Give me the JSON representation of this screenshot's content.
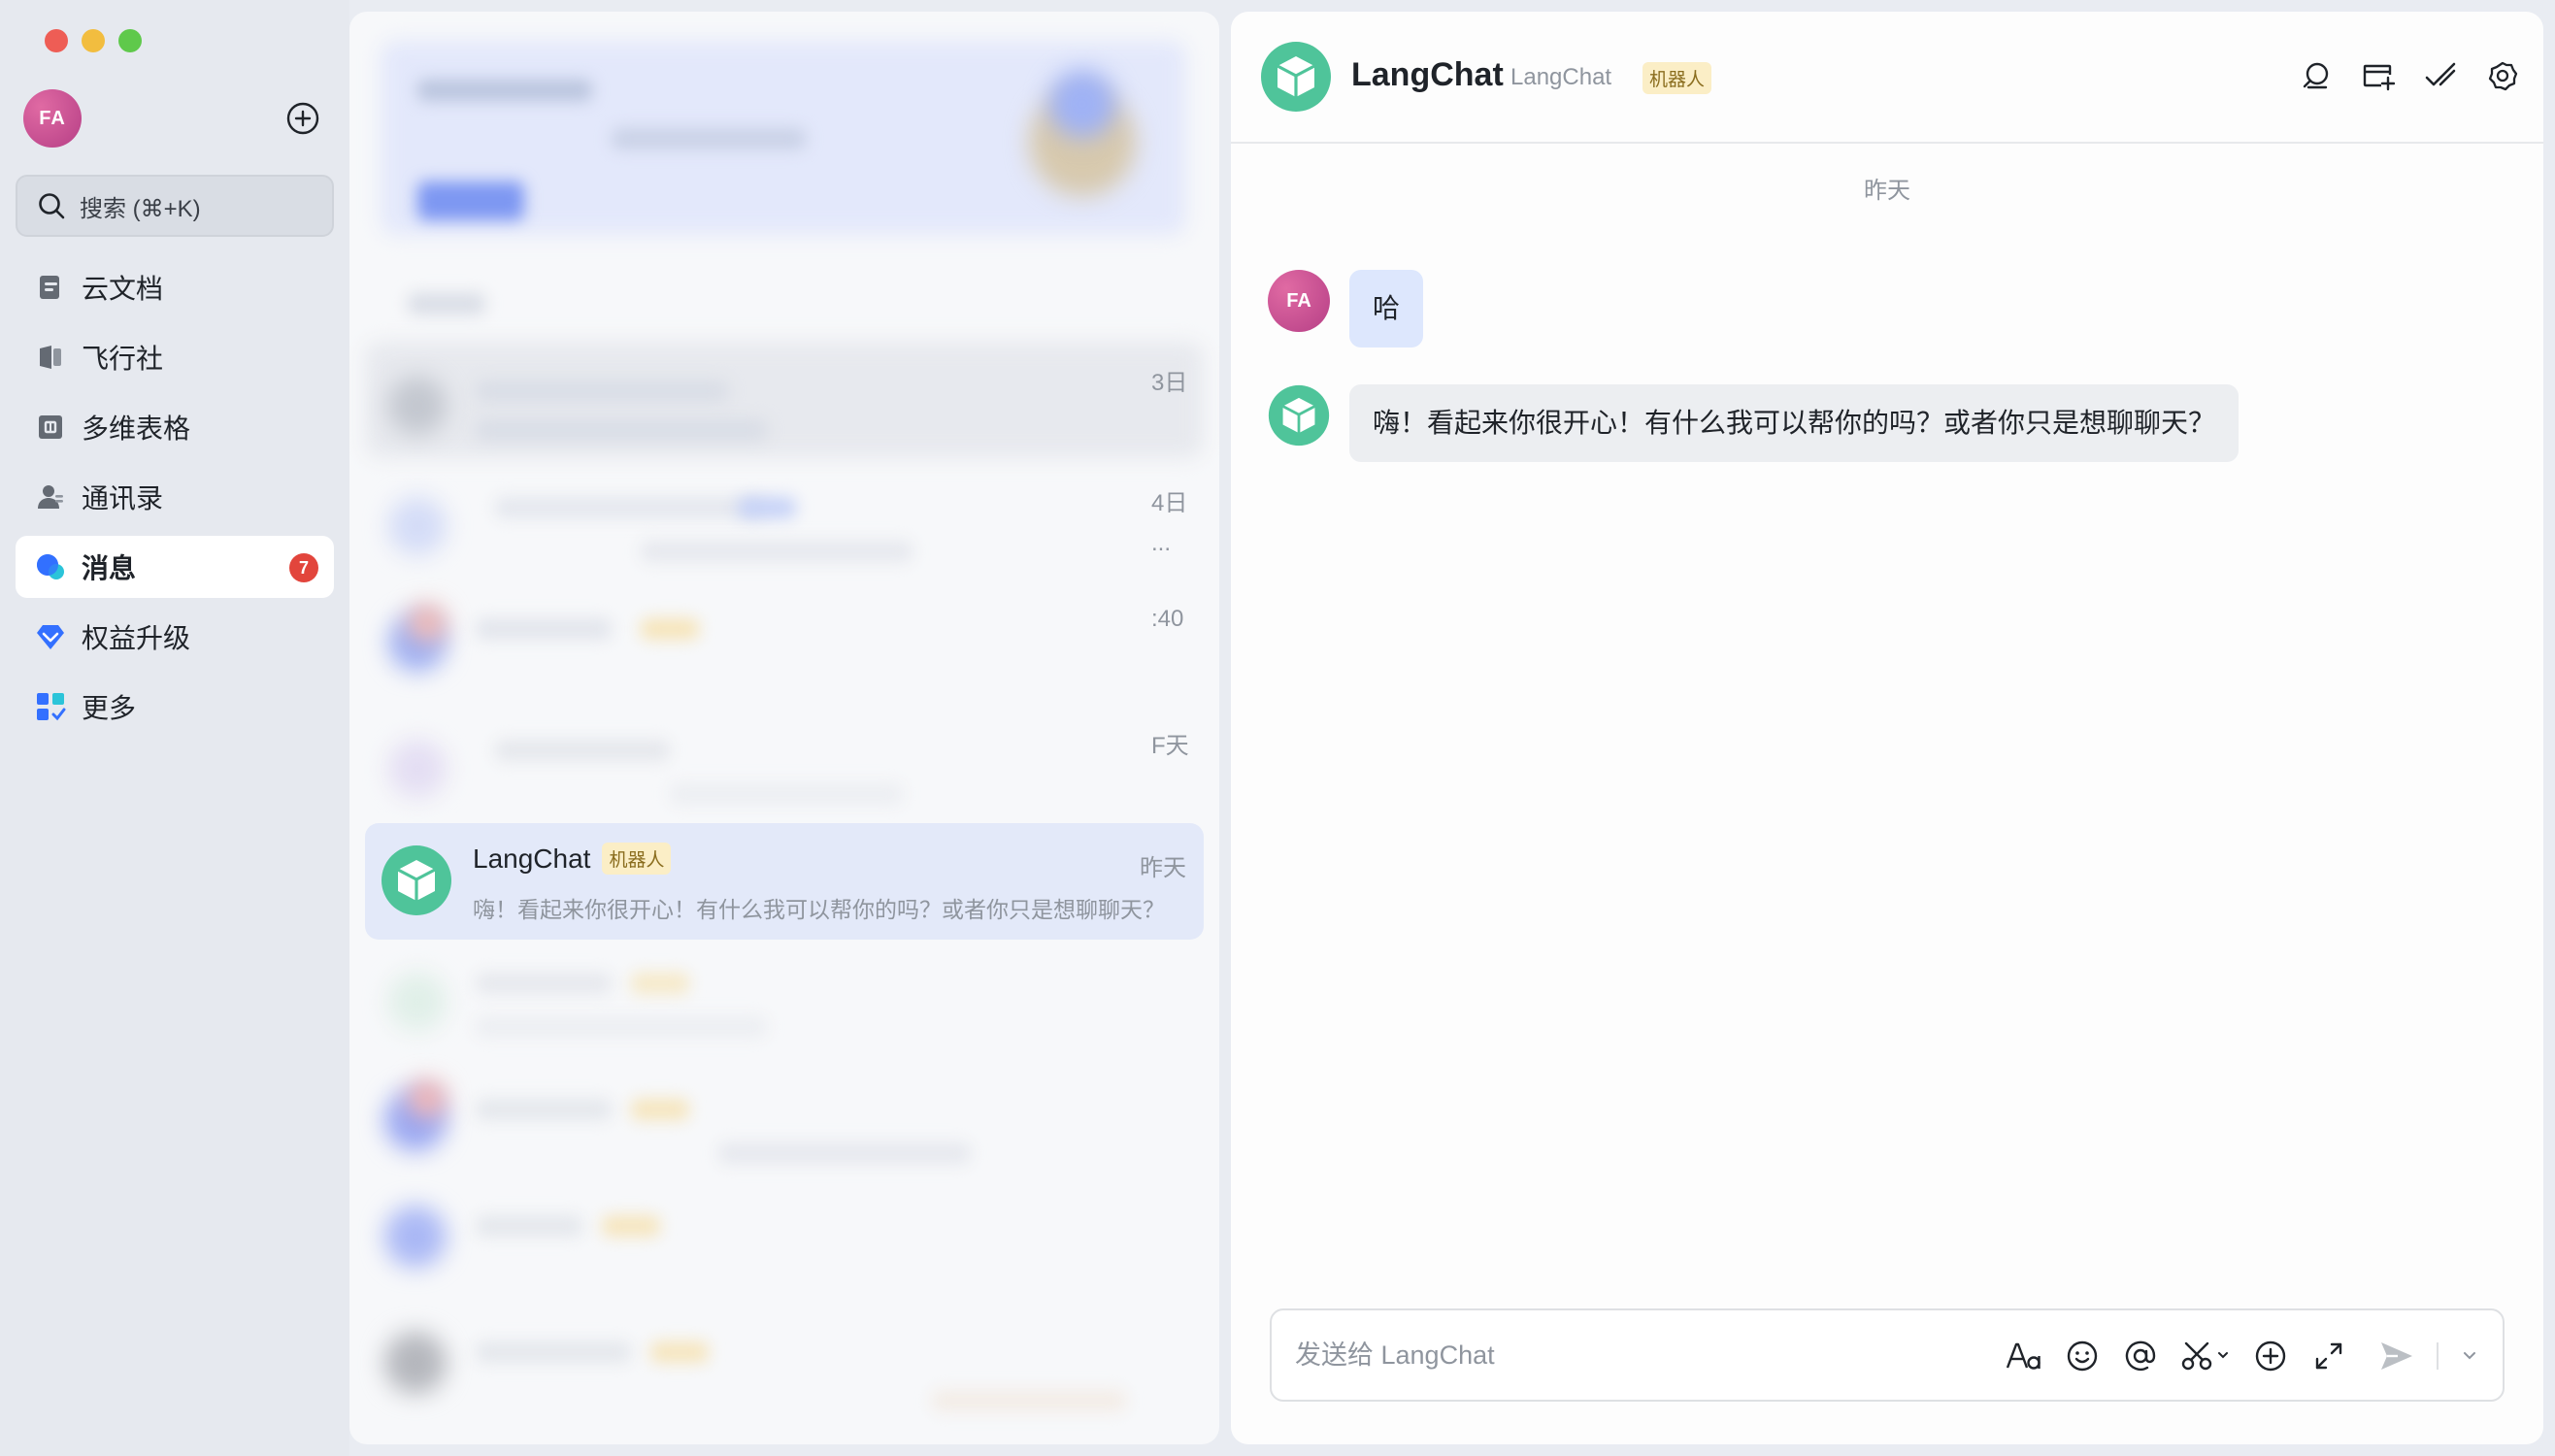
{
  "sidebar": {
    "avatar_initials": "FA",
    "search_placeholder": "搜索 (⌘+K)",
    "nav": [
      {
        "label": "云文档",
        "icon": "docs-icon"
      },
      {
        "label": "飞行社",
        "icon": "community-icon"
      },
      {
        "label": "多维表格",
        "icon": "base-table-icon"
      },
      {
        "label": "通讯录",
        "icon": "contacts-icon"
      },
      {
        "label": "消息",
        "icon": "messages-icon",
        "badge": "7",
        "active": true
      },
      {
        "label": "权益升级",
        "icon": "upgrade-diamond-icon"
      },
      {
        "label": "更多",
        "icon": "apps-grid-icon"
      }
    ]
  },
  "conversation_list": {
    "stray_times": [
      "3日",
      "4日",
      "...",
      ":40",
      "F天"
    ],
    "active": {
      "name": "LangChat",
      "tag": "机器人",
      "time": "昨天",
      "preview": "嗨！看起来你很开心！有什么我可以帮你的吗？或者你只是想聊聊天？"
    }
  },
  "chat": {
    "title": "LangChat",
    "subtitle": "LangChat",
    "tag": "机器人",
    "date_separator": "昨天",
    "messages": [
      {
        "from": "me",
        "avatar": "FA",
        "text": "哈"
      },
      {
        "from": "bot",
        "text": "嗨！看起来你很开心！有什么我可以帮你的吗？或者你只是想聊聊天？"
      }
    ],
    "composer_placeholder": "发送给 LangChat"
  },
  "colors": {
    "accent": "#3370ff",
    "bot_green": "#4fc49a",
    "badge_red": "#e2453c",
    "tag_bg": "#fbeec6"
  }
}
